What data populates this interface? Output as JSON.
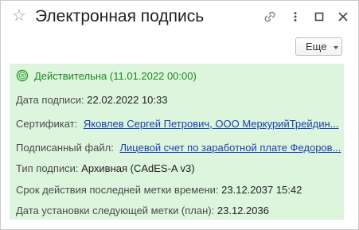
{
  "window": {
    "title": "Электронная подпись"
  },
  "toolbar": {
    "more_label": "Еще"
  },
  "signature": {
    "status": "Действительна (11.01.2022 00:00)",
    "status_color": "#1c8a1c",
    "panel_color": "#dcf5dc",
    "fields": {
      "date": {
        "label": "Дата подписи:",
        "value": "22.02.2022 10:33"
      },
      "certificate": {
        "label": "Сертификат:",
        "value": "Яковлев Сергей Петрович, ООО  МеркурийТрейдин..."
      },
      "file": {
        "label": "Подписанный файл:",
        "value": "Лицевой счет по заработной плате Федоров..."
      },
      "type": {
        "label": "Тип подписи:",
        "value": "Архивная (CAdES-A v3)"
      },
      "last_stamp": {
        "label": "Срок действия последней метки времени:",
        "value": "23.12.2037 15:42"
      },
      "next_stamp": {
        "label": "Дата установки следующей метки (план):",
        "value": "23.12.2036"
      }
    }
  },
  "icons": {
    "favorite": "star-icon",
    "link": "link-icon",
    "menu": "more-vertical-icon",
    "maximize": "maximize-icon",
    "close": "close-icon",
    "status": "valid-signature-icon"
  }
}
